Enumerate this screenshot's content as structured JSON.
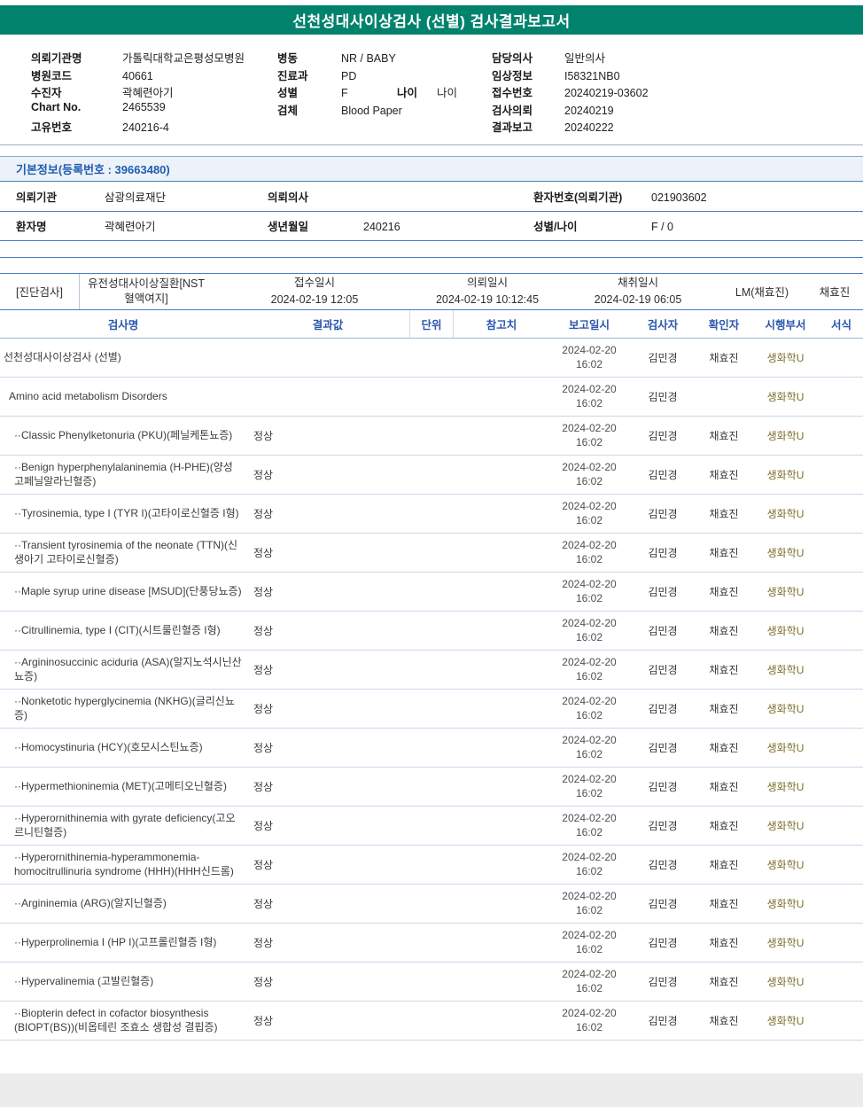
{
  "title": "선천성대사이상검사 (선별) 검사결과보고서",
  "colors": {
    "header_bar": "#00826d",
    "table_header_text": "#2b57ad",
    "section_title_text": "#1f5bb5",
    "dept_text": "#7e6f2d",
    "strong_border": "#4a7cc0",
    "light_border": "#c9d9ec"
  },
  "patient_header": {
    "left": [
      {
        "label": "의뢰기관명",
        "value": "가톨릭대학교은평성모병원"
      },
      {
        "label": "병원코드",
        "value": "40661"
      },
      {
        "label": "수진자",
        "value": "곽혜련아기"
      },
      {
        "label": "Chart No.",
        "value": "2465539"
      },
      {
        "label": "고유번호",
        "value": "240216-4"
      }
    ],
    "middle": [
      {
        "label": "병동",
        "value": "NR / BABY"
      },
      {
        "label": "진료과",
        "value": "PD"
      },
      {
        "label": "성별",
        "value": "F"
      },
      {
        "label": "검체",
        "value": "Blood Paper"
      }
    ],
    "middle_extra": {
      "label": "나이",
      "value": "나이"
    },
    "right": [
      {
        "label": "담당의사",
        "value": "일반의사"
      },
      {
        "label": "임상정보",
        "value": "I58321NB0"
      },
      {
        "label": "접수번호",
        "value": "20240219-03602"
      },
      {
        "label": "검사의뢰",
        "value": "20240219"
      },
      {
        "label": "결과보고",
        "value": "20240222"
      }
    ]
  },
  "basic_info": {
    "title": "기본정보(등록번호 : 39663480)",
    "row1": {
      "l1": "의뢰기관",
      "v1": "삼광의료재단",
      "l2": "의뢰의사",
      "v2": "",
      "l3": "환자번호(의뢰기관)",
      "v3": "021903602"
    },
    "row2": {
      "l1": "환자명",
      "v1": "곽혜련아기",
      "l2": "생년월일",
      "v2": "240216",
      "l3": "성별/나이",
      "v3": "F / 0"
    }
  },
  "exam": {
    "tag": "[진단검사]",
    "test_name": "유전성대사이상질환[NST 혈액여지]",
    "received_label": "접수일시",
    "received": "2024-02-19 12:05",
    "requested_label": "의뢰일시",
    "requested": "2024-02-19 10:12:45",
    "collected_label": "채취일시",
    "collected": "2024-02-19 06:05",
    "lm": "LM(채효진)",
    "collector": "채효진"
  },
  "results_table": {
    "headers": [
      "검사명",
      "결과값",
      "단위",
      "참고치",
      "보고일시",
      "검사자",
      "확인자",
      "시행부서",
      "서식"
    ],
    "rows": [
      {
        "level": 0,
        "name": "선천성대사이상검사 (선별)",
        "result": "",
        "unit": "",
        "ref": "",
        "report_date": "2024-02-20",
        "report_time": "16:02",
        "tester": "김민경",
        "confirmer": "채효진",
        "dept": "생화학U"
      },
      {
        "level": 1,
        "name": "Amino acid metabolism Disorders",
        "result": "",
        "unit": "",
        "ref": "",
        "report_date": "2024-02-20",
        "report_time": "16:02",
        "tester": "김민경",
        "confirmer": "",
        "dept": "생화학U"
      },
      {
        "level": 2,
        "name": "··Classic Phenylketonuria (PKU)(페닐케톤뇨증)",
        "result": "정상",
        "unit": "",
        "ref": "",
        "report_date": "2024-02-20",
        "report_time": "16:02",
        "tester": "김민경",
        "confirmer": "채효진",
        "dept": "생화학U"
      },
      {
        "level": 2,
        "name": "··Benign hyperphenylalaninemia (H-PHE)(양성 고페닐알라닌혈증)",
        "result": "정상",
        "unit": "",
        "ref": "",
        "report_date": "2024-02-20",
        "report_time": "16:02",
        "tester": "김민경",
        "confirmer": "채효진",
        "dept": "생화학U"
      },
      {
        "level": 2,
        "name": "··Tyrosinemia, type I (TYR I)(고타이로신혈증 I형)",
        "result": "정상",
        "unit": "",
        "ref": "",
        "report_date": "2024-02-20",
        "report_time": "16:02",
        "tester": "김민경",
        "confirmer": "채효진",
        "dept": "생화학U"
      },
      {
        "level": 2,
        "name": "··Transient tyrosinemia of the neonate (TTN)(신생아기 고타이로신혈증)",
        "result": "정상",
        "unit": "",
        "ref": "",
        "report_date": "2024-02-20",
        "report_time": "16:02",
        "tester": "김민경",
        "confirmer": "채효진",
        "dept": "생화학U"
      },
      {
        "level": 2,
        "name": "··Maple syrup urine disease [MSUD](단풍당뇨증)",
        "result": "정상",
        "unit": "",
        "ref": "",
        "report_date": "2024-02-20",
        "report_time": "16:02",
        "tester": "김민경",
        "confirmer": "채효진",
        "dept": "생화학U"
      },
      {
        "level": 2,
        "name": "··Citrullinemia, type I (CIT)(시트룰린혈증 I형)",
        "result": "정상",
        "unit": "",
        "ref": "",
        "report_date": "2024-02-20",
        "report_time": "16:02",
        "tester": "김민경",
        "confirmer": "채효진",
        "dept": "생화학U"
      },
      {
        "level": 2,
        "name": "··Argininosuccinic aciduria (ASA)(알지노석시닌산뇨증)",
        "result": "정상",
        "unit": "",
        "ref": "",
        "report_date": "2024-02-20",
        "report_time": "16:02",
        "tester": "김민경",
        "confirmer": "채효진",
        "dept": "생화학U"
      },
      {
        "level": 2,
        "name": "··Nonketotic hyperglycinemia (NKHG)(글리신뇨증)",
        "result": "정상",
        "unit": "",
        "ref": "",
        "report_date": "2024-02-20",
        "report_time": "16:02",
        "tester": "김민경",
        "confirmer": "채효진",
        "dept": "생화학U"
      },
      {
        "level": 2,
        "name": "··Homocystinuria (HCY)(호모시스틴뇨증)",
        "result": "정상",
        "unit": "",
        "ref": "",
        "report_date": "2024-02-20",
        "report_time": "16:02",
        "tester": "김민경",
        "confirmer": "채효진",
        "dept": "생화학U"
      },
      {
        "level": 2,
        "name": "··Hypermethioninemia (MET)(고메티오닌혈증)",
        "result": "정상",
        "unit": "",
        "ref": "",
        "report_date": "2024-02-20",
        "report_time": "16:02",
        "tester": "김민경",
        "confirmer": "채효진",
        "dept": "생화학U"
      },
      {
        "level": 2,
        "name": "··Hyperornithinemia with gyrate deficiency(고오르니틴혈증)",
        "result": "정상",
        "unit": "",
        "ref": "",
        "report_date": "2024-02-20",
        "report_time": "16:02",
        "tester": "김민경",
        "confirmer": "채효진",
        "dept": "생화학U"
      },
      {
        "level": 2,
        "name": "··Hyperornithinemia-hyperammonemia-homocitrullinuria syndrome (HHH)(HHH신드롬)",
        "result": "정상",
        "unit": "",
        "ref": "",
        "report_date": "2024-02-20",
        "report_time": "16:02",
        "tester": "김민경",
        "confirmer": "채효진",
        "dept": "생화학U"
      },
      {
        "level": 2,
        "name": "··Argininemia (ARG)(알지닌혈증)",
        "result": "정상",
        "unit": "",
        "ref": "",
        "report_date": "2024-02-20",
        "report_time": "16:02",
        "tester": "김민경",
        "confirmer": "채효진",
        "dept": "생화학U"
      },
      {
        "level": 2,
        "name": "··Hyperprolinemia I (HP I)(고프롤린혈증 I형)",
        "result": "정상",
        "unit": "",
        "ref": "",
        "report_date": "2024-02-20",
        "report_time": "16:02",
        "tester": "김민경",
        "confirmer": "채효진",
        "dept": "생화학U"
      },
      {
        "level": 2,
        "name": "··Hypervalinemia (고발린혈증)",
        "result": "정상",
        "unit": "",
        "ref": "",
        "report_date": "2024-02-20",
        "report_time": "16:02",
        "tester": "김민경",
        "confirmer": "채효진",
        "dept": "생화학U"
      },
      {
        "level": 2,
        "name": "··Biopterin defect in cofactor biosynthesis (BIOPT(BS))(비옵테린 조효소 생합성 결핍증)",
        "result": "정상",
        "unit": "",
        "ref": "",
        "report_date": "2024-02-20",
        "report_time": "16:02",
        "tester": "김민경",
        "confirmer": "채효진",
        "dept": "생화학U"
      }
    ]
  }
}
